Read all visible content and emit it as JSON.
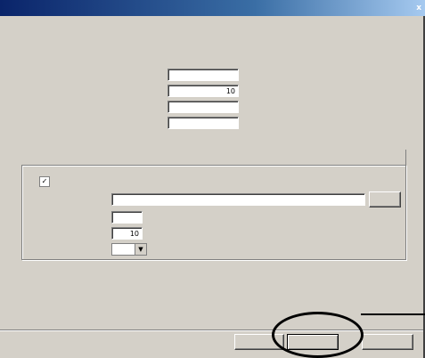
{
  "window": {
    "title": "",
    "close_glyph": "x"
  },
  "page": {
    "heading": "",
    "subtitle": ""
  },
  "fields": [
    {
      "label": "",
      "value": "",
      "unit": ""
    },
    {
      "label": "",
      "value": "10",
      "unit": ""
    },
    {
      "label": "",
      "value": "",
      "unit": ""
    },
    {
      "label": "",
      "value": "",
      "unit": ""
    }
  ],
  "group": {
    "label": "",
    "checkbox_label": "",
    "checkbox_checked": true,
    "path_label": "",
    "path_value": "",
    "browse_label": "",
    "opt1_label": "",
    "opt1_value": "",
    "opt1_unit": "",
    "opt2_label": "",
    "opt2_value": "10",
    "opt3_label": "",
    "opt3_value": ""
  },
  "buttons": {
    "back": "",
    "next": "",
    "cancel": ""
  },
  "icons": {
    "close": "close-icon",
    "check": "check-icon",
    "dropdown": "chevron-down-icon"
  }
}
